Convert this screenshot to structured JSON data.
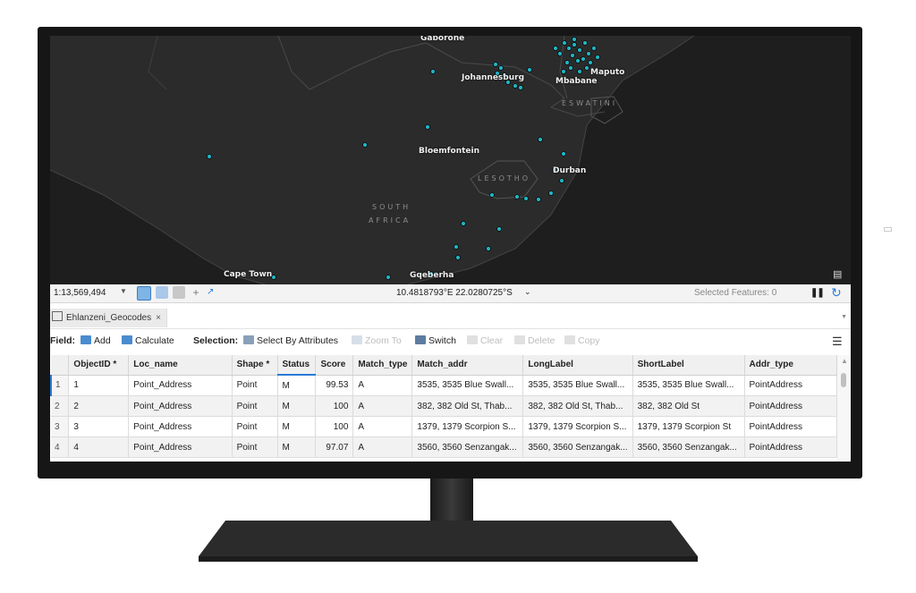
{
  "map": {
    "cities": [
      "Gaborone",
      "Johannesburg",
      "Mbabane",
      "Maputo",
      "Bloemfontein",
      "Durban",
      "Cape Town",
      "Gqeberha"
    ],
    "regions": [
      "ESWATINI",
      "LESOTHO",
      "SOUTH",
      "AFRICA"
    ],
    "point_color": "#1fb5c4"
  },
  "statusbar": {
    "scale": "1:13,569,494",
    "coordinates": "10.4818793°E 22.0280725°S",
    "selected_features": "Selected Features: 0"
  },
  "tab": {
    "title": "Ehlanzeni_Geocodes",
    "close": "×"
  },
  "toolbar": {
    "field_label": "Field:",
    "add": "Add",
    "calculate": "Calculate",
    "selection_label": "Selection:",
    "select_by_attributes": "Select By Attributes",
    "zoom_to": "Zoom To",
    "switch": "Switch",
    "clear": "Clear",
    "delete": "Delete",
    "copy": "Copy"
  },
  "table": {
    "columns": [
      "ObjectID *",
      "Loc_name",
      "Shape *",
      "Status",
      "Score",
      "Match_type",
      "Match_addr",
      "LongLabel",
      "ShortLabel",
      "Addr_type"
    ],
    "rows": [
      [
        "1",
        "1",
        "Point_Address",
        "Point",
        "M",
        "99.53",
        "A",
        "3535, 3535 Blue Swall...",
        "3535, 3535 Blue Swall...",
        "3535, 3535 Blue Swall...",
        "PointAddress"
      ],
      [
        "2",
        "2",
        "Point_Address",
        "Point",
        "M",
        "100",
        "A",
        "382, 382 Old St, Thab...",
        "382, 382 Old St, Thab...",
        "382, 382 Old St",
        "PointAddress"
      ],
      [
        "3",
        "3",
        "Point_Address",
        "Point",
        "M",
        "100",
        "A",
        "1379, 1379 Scorpion S...",
        "1379, 1379 Scorpion S...",
        "1379, 1379 Scorpion St",
        "PointAddress"
      ],
      [
        "4",
        "4",
        "Point_Address",
        "Point",
        "M",
        "97.07",
        "A",
        "3560, 3560 Senzangak...",
        "3560, 3560 Senzangak...",
        "3560, 3560 Senzangak...",
        "PointAddress"
      ]
    ]
  }
}
